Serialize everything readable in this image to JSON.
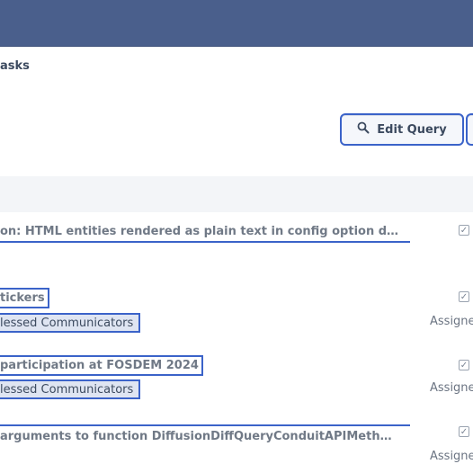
{
  "breadcrumb": {
    "label": "asks"
  },
  "toolbar": {
    "edit_query_label": "Edit Query",
    "edit_query_icon": "search-icon"
  },
  "tasks": [
    {
      "title": "on: HTML entities rendered as plain text in config option d…",
      "tag": "",
      "assigned": ""
    },
    {
      "title": "tickers",
      "tag": "lessed Communicators",
      "assigned": "Assigne"
    },
    {
      "title": "participation at FOSDEM 2024",
      "tag": "lessed Communicators",
      "assigned": "Assigne"
    },
    {
      "title": "arguments to function DiffusionDiffQueryConduitAPIMeth…",
      "tag": "",
      "assigned": "Assigne"
    }
  ],
  "colors": {
    "topbar": "#4a5f8c",
    "accent": "#3b63c9",
    "tag_bg": "#dfe5f2"
  }
}
